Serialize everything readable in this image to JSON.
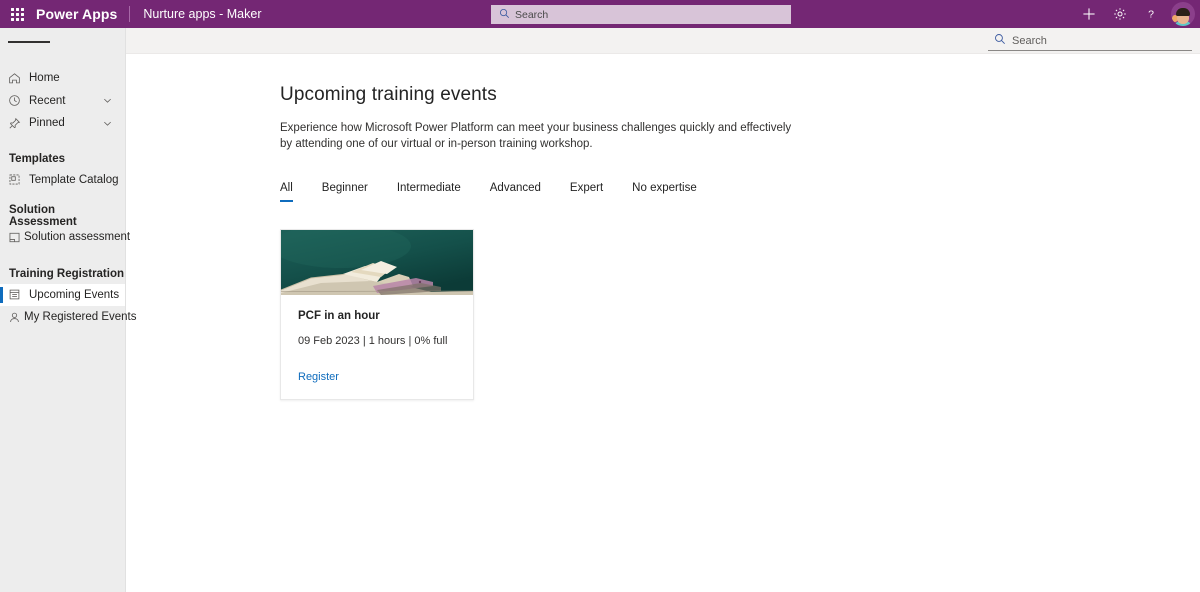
{
  "suitebar": {
    "waffle_icon": "waffle-grid-icon",
    "brand": "Power Apps",
    "app_name": "Nurture apps - Maker",
    "search_placeholder": "Search",
    "search_icon": "search-icon",
    "add_icon": "plus-icon",
    "settings_icon": "gear-icon",
    "help_icon": "question-mark-icon",
    "avatar_icon": "avatar",
    "background_color": "#742774"
  },
  "sidebar": {
    "menu_icon": "hamburger-menu-icon",
    "items": [
      {
        "label": "Home",
        "icon": "home-icon",
        "selected": false,
        "expandable": false
      },
      {
        "label": "Recent",
        "icon": "clock-icon",
        "selected": false,
        "expandable": true
      },
      {
        "label": "Pinned",
        "icon": "pin-icon",
        "selected": false,
        "expandable": true
      }
    ],
    "groups": [
      {
        "title": "Templates",
        "items": [
          {
            "label": "Template Catalog",
            "icon": "template-catalog-icon",
            "selected": false
          }
        ]
      },
      {
        "title": "Solution Assessment",
        "items": [
          {
            "label": "Solution assessment",
            "icon": "solution-assessment-icon",
            "selected": false
          }
        ]
      },
      {
        "title": "Training Registration",
        "items": [
          {
            "label": "Upcoming Events",
            "icon": "upcoming-events-icon",
            "selected": true
          },
          {
            "label": "My Registered Events",
            "icon": "person-icon",
            "selected": false
          }
        ]
      }
    ],
    "selection_color": "#0f6cbd"
  },
  "command_bar": {
    "search_placeholder": "Search",
    "search_icon": "search-icon"
  },
  "main": {
    "title": "Upcoming training events",
    "description": "Experience how Microsoft Power Platform can meet your business challenges quickly and effectively by attending one of our virtual or in-person training workshop.",
    "tabs": [
      {
        "label": "All",
        "active": true
      },
      {
        "label": "Beginner",
        "active": false
      },
      {
        "label": "Intermediate",
        "active": false
      },
      {
        "label": "Advanced",
        "active": false
      },
      {
        "label": "Expert",
        "active": false
      },
      {
        "label": "No expertise",
        "active": false
      }
    ],
    "tab_accent_color": "#0f6cbd",
    "cards": [
      {
        "image_alt": "open-book-on-chalkboard-image",
        "title": "PCF in an hour",
        "meta": "09 Feb 2023 | 1 hours | 0% full",
        "action_label": "Register",
        "action_color": "#0f6cbd"
      }
    ]
  }
}
